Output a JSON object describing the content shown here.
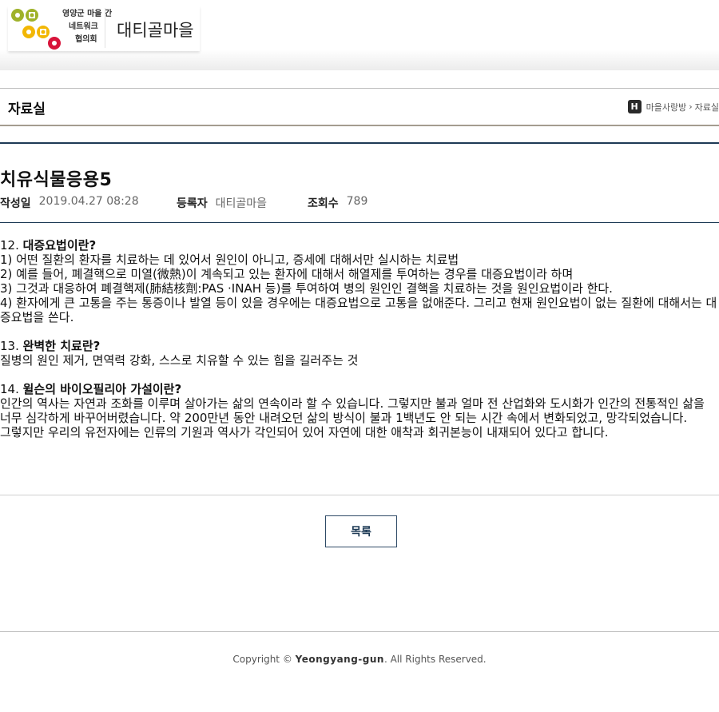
{
  "header": {
    "logo_line1": "영양군 마을 간",
    "logo_line2": "네트워크",
    "logo_line3": "협의회",
    "village_name": "대티골마을"
  },
  "section": {
    "title": "자료실",
    "breadcrumb_home": "H",
    "breadcrumb_1": "마을사랑방",
    "breadcrumb_2": "자료실"
  },
  "post": {
    "title": "치유식물응용5",
    "meta": {
      "date_label": "작성일",
      "date": "2019.04.27 08:28",
      "author_label": "등록자",
      "author": "대티골마을",
      "views_label": "조회수",
      "views": "789"
    },
    "content": {
      "q12_num": "12. ",
      "q12_title": "대증요법이란",
      "q12_mark": "?",
      "line1": "1) 어떤 질환의 환자를 치료하는 데 있어서 원인이 아니고, 증세에 대해서만 실시하는 치료법",
      "line2": "2) 예를 들어, 폐결핵으로 미열(微熱)이 계속되고 있는 환자에 대해서 해열제를 투여하는 경우를 대증요법이라 하며",
      "line3": "3) 그것과 대응하여 폐결핵제(肺結核劑:PAS ·INAH 등)를 투여하여 병의 원인인 결핵을 치료하는 것을 원인요법이라 한다.",
      "line4": "4) 환자에게 큰 고통을 주는 통증이나 발열 등이 있을 경우에는 대증요법으로 고통을 없애준다. 그리고 현재 원인요법이 없는 질환에 대해서는 대증요법을 쓴다.",
      "q13_num": "13. ",
      "q13_title": "완벽한 치료란",
      "q13_mark": "?",
      "q13_body": "질병의 원인 제거, 면역력 강화, 스스로 치유할 수 있는 힘을 길러주는 것",
      "q14_num": "14. ",
      "q14_title": "윌슨의 바이오필리아 가설이란",
      "q14_mark": "?",
      "q14_body1": "인간의 역사는 자연과 조화를 이루며 살아가는 삶의 연속이라 할 수 있습니다. 그렇지만 불과 얼마 전 산업화와 도시화가 인간의 전통적인 삶을 너무 심각하게 바꾸어버렸습니다. 약 200만년 동안 내려오던 삶의 방식이 불과 1백년도 안 되는 시간 속에서 변화되었고, 망각되었습니다.",
      "q14_body2": "그렇지만 우리의 유전자에는 인류의 기원과 역사가 각인되어 있어 자연에 대한 애착과 회귀본능이 내재되어 있다고 합니다."
    }
  },
  "list_button": "목록",
  "footer": {
    "prefix": "Copyright © ",
    "brand": "Yeongyang-gun",
    "suffix": ". All Rights Reserved."
  },
  "colors": {
    "accent_navy": "#1d3a55",
    "logo_olive": "#9fb22a",
    "logo_yellow": "#f2b705",
    "logo_red": "#d8143a"
  }
}
